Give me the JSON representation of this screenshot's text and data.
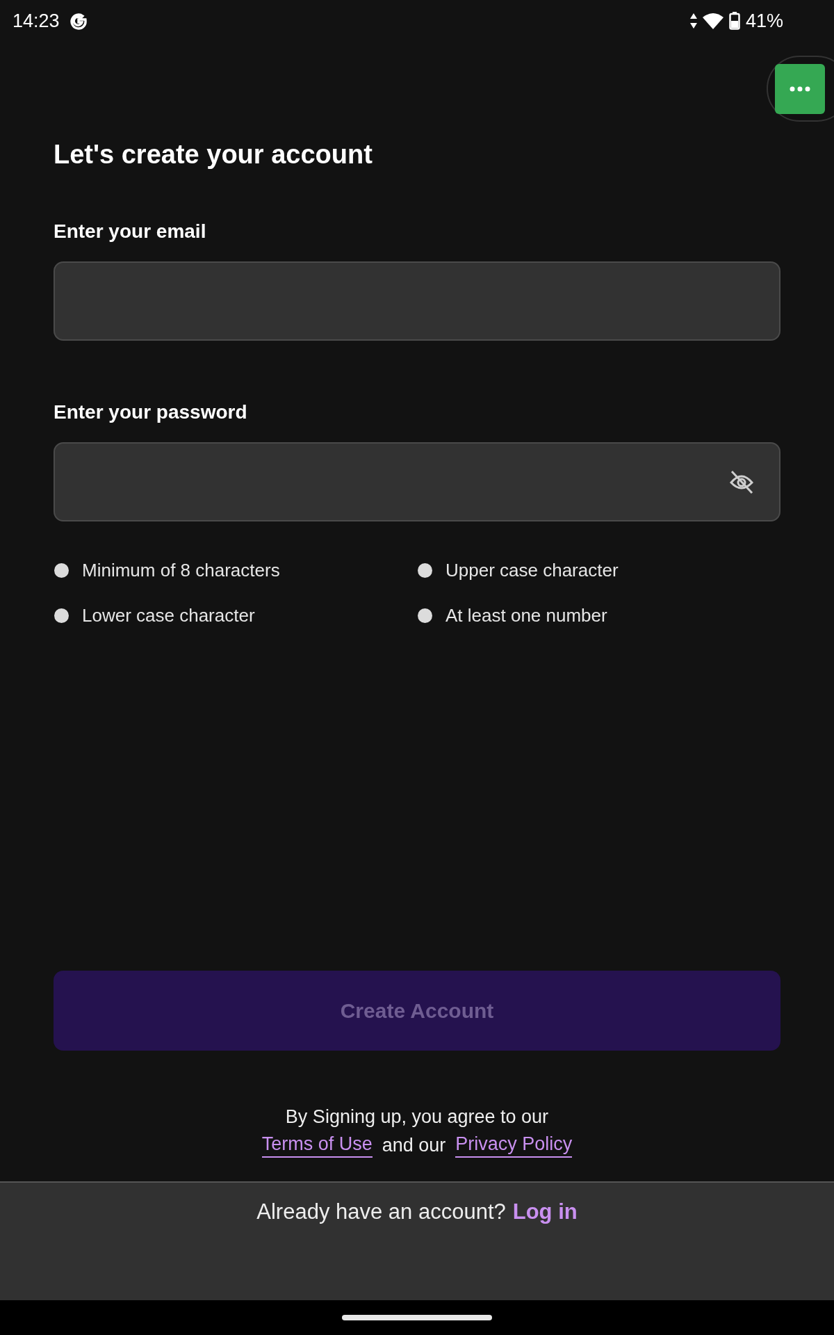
{
  "status_bar": {
    "time": "14:23",
    "battery": "41%"
  },
  "title": "Let's create your account",
  "email": {
    "label": "Enter your email"
  },
  "password": {
    "label": "Enter your password",
    "visible": false
  },
  "requirements": [
    {
      "label": "Minimum of 8 characters",
      "met": false
    },
    {
      "label": "Upper case character",
      "met": false
    },
    {
      "label": "Lower case character",
      "met": false
    },
    {
      "label": "At least one number",
      "met": false
    }
  ],
  "create_button": {
    "label": "Create Account",
    "disabled": true
  },
  "terms": {
    "text": "By Signing up, you agree to our",
    "terms_link": "Terms of Use",
    "joiner": "and our",
    "privacy_link": "Privacy Policy"
  },
  "footer": {
    "text": "Already have an account?",
    "link": "Log in"
  }
}
